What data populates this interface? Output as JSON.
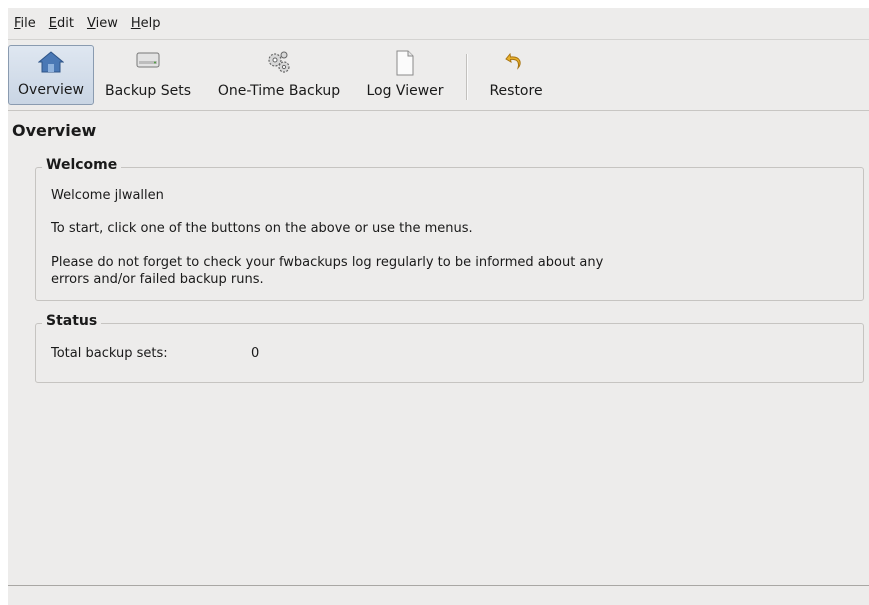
{
  "menubar": {
    "items": [
      {
        "mnemonic": "F",
        "rest": "ile"
      },
      {
        "mnemonic": "E",
        "rest": "dit"
      },
      {
        "mnemonic": "V",
        "rest": "iew"
      },
      {
        "mnemonic": "H",
        "rest": "elp"
      }
    ]
  },
  "toolbar": {
    "buttons": [
      {
        "label": "Overview",
        "icon": "home-icon",
        "active": true
      },
      {
        "label": "Backup Sets",
        "icon": "drive-icon"
      },
      {
        "label": "One-Time Backup",
        "icon": "gears-icon"
      },
      {
        "label": "Log Viewer",
        "icon": "document-icon"
      },
      {
        "label": "Restore",
        "icon": "undo-arrow-icon"
      }
    ]
  },
  "main": {
    "title": "Overview",
    "welcome": {
      "heading": "Welcome",
      "greeting": "Welcome jlwallen",
      "instruction": "To start, click one of the buttons on the above or use the menus.",
      "reminder_line1": "Please do not forget to check your fwbackups log regularly to be informed about any",
      "reminder_line2": "errors and/or failed backup runs."
    },
    "status": {
      "heading": "Status",
      "label": "Total backup sets:",
      "value": "0"
    }
  },
  "colors": {
    "window_bg": "#edeceb",
    "active_button": "#c9d5e4",
    "home_icon": "#4a78b5",
    "restore_icon": "#e8b02a"
  }
}
